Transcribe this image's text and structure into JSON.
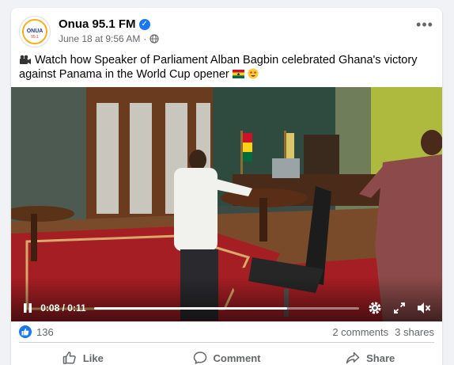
{
  "post": {
    "page_name": "Onua 95.1 FM",
    "verified_icon": "verified-badge-icon",
    "date": "June 18 at 9:56 AM",
    "separator": "·",
    "audience_icon": "globe-icon",
    "more_icon": "more-options-icon",
    "caption_icon": "video-camera-icon",
    "caption": "Watch how Speaker of Parliament Alban Bagbin celebrated Ghana's victory against Panama in the World Cup opener",
    "caption_emojis": [
      "ghana-flag-emoji",
      "star-struck-emoji"
    ]
  },
  "avatar": {
    "logo_text": "ONUA",
    "logo_sub": "95.1"
  },
  "video": {
    "current_time": "0:08",
    "duration": "0:11",
    "time_separator": " / ",
    "progress": 0.73
  },
  "reactions": {
    "count": "136",
    "comments": "2 comments",
    "shares": "3 shares"
  },
  "actions": {
    "like": "Like",
    "comment": "Comment",
    "share": "Share"
  },
  "colors": {
    "brand": "#1877f2",
    "secondary_text": "#65676b",
    "carpet": "#a51e24"
  }
}
